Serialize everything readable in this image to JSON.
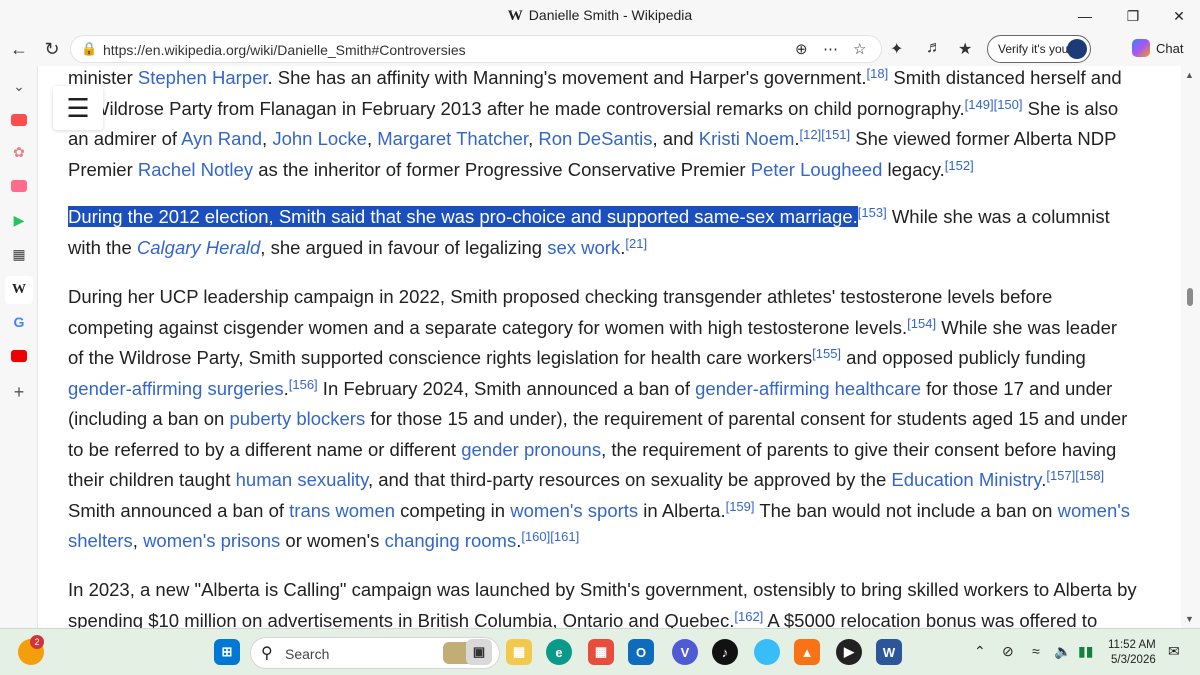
{
  "window": {
    "title": "Danielle Smith - Wikipedia",
    "logo": "W"
  },
  "toolbar": {
    "url": "https://en.wikipedia.org/wiki/Danielle_Smith#Controversies",
    "verify_label": "Verify it's you",
    "chat_label": "Chat"
  },
  "article": {
    "p1": {
      "l1a": "minister ",
      "l1link": "Stephen Harper",
      "l1b": ". She has an affinity with Manning's movement and Harper's government.",
      "l1ref": "[18]",
      "l1c": " Smith distanced herself and",
      "l2a": "Wildrose Party from Flanagan in February 2013 after he made controversial remarks on child pornography.",
      "l2ref1": "[149]",
      "l2ref2": "[150]",
      "l2b": " She is also",
      "l3a": "an admirer of ",
      "l3k1": "Ayn Rand",
      "l3s1": ", ",
      "l3k2": "John Locke",
      "l3s2": ", ",
      "l3k3": "Margaret Thatcher",
      "l3s3": ", ",
      "l3k4": "Ron DeSantis",
      "l3s4": ", and ",
      "l3k5": "Kristi Noem",
      "l3s5": ".",
      "l3ref1": "[12]",
      "l3ref2": "[151]",
      "l3b": " She viewed former Alberta NDP",
      "l4a": "Premier ",
      "l4k1": "Rachel Notley",
      "l4b": " as the inheritor of former Progressive Conservative Premier ",
      "l4k2": "Peter Lougheed",
      "l4c": " legacy.",
      "l4ref": "[152]"
    },
    "p2": {
      "highlight": "During the 2012 election, Smith said that she was pro-choice and supported same-sex marriage.",
      "ref1": "[153]",
      "a": " While she was a columnist",
      "b": "with the ",
      "k1": "Calgary Herald",
      "c": ", she argued in favour of legalizing ",
      "k2": "sex work",
      "d": ".",
      "ref2": "[21]"
    },
    "p3": {
      "l1": "During her UCP leadership campaign in 2022, Smith proposed checking transgender athletes' testosterone levels before",
      "l2a": "competing against cisgender women and a separate category for women with high testosterone levels.",
      "l2ref": "[154]",
      "l2b": " While she was leader",
      "l3a": "of the Wildrose Party, Smith supported conscience rights legislation for health care workers",
      "l3ref": "[155]",
      "l3b": " and opposed publicly funding",
      "l4k1": "gender-affirming surgeries",
      "l4a": ".",
      "l4ref": "[156]",
      "l4b": " In February 2024, Smith announced a ban of ",
      "l4k2": "gender-affirming healthcare",
      "l4c": " for those 17 and under",
      "l5a": "(including a ban on ",
      "l5k1": "puberty blockers",
      "l5b": " for those 15 and under), the requirement of parental consent for students aged 15 and under",
      "l6a": "to be referred to by a different name or different ",
      "l6k1": "gender pronouns",
      "l6b": ", the requirement of parents to give their consent before having",
      "l7a": "their children taught ",
      "l7k1": "human sexuality",
      "l7b": ", and that third-party resources on sexuality be approved by the ",
      "l7k2": "Education Ministry",
      "l7c": ".",
      "l7ref1": "[157]",
      "l7ref2": "[158]",
      "l8a": "Smith announced a ban of ",
      "l8k1": "trans women",
      "l8b": " competing in ",
      "l8k2": "women's sports",
      "l8c": " in Alberta.",
      "l8ref": "[159]",
      "l8d": " The ban would not include a ban on ",
      "l8k3": "women's",
      "l9k1": "shelters",
      "l9a": ", ",
      "l9k2": "women's prisons",
      "l9b": " or women's ",
      "l9k3": "changing rooms",
      "l9c": ".",
      "l9ref1": "[160]",
      "l9ref2": "[161]"
    },
    "p4": {
      "l1": "In 2023, a new \"Alberta is Calling\" campaign was launched by Smith's government, ostensibly to bring skilled workers to Alberta by",
      "l2a": "spending $10 million on advertisements in British Columbia, Ontario and Quebec.",
      "l2ref": "[162]",
      "l2b": " A $5000 relocation bonus was offered to"
    }
  },
  "taskbar": {
    "weather_badge": "2",
    "search_label": "Search",
    "time": "11:52 AM",
    "date": "5/3/2026"
  }
}
